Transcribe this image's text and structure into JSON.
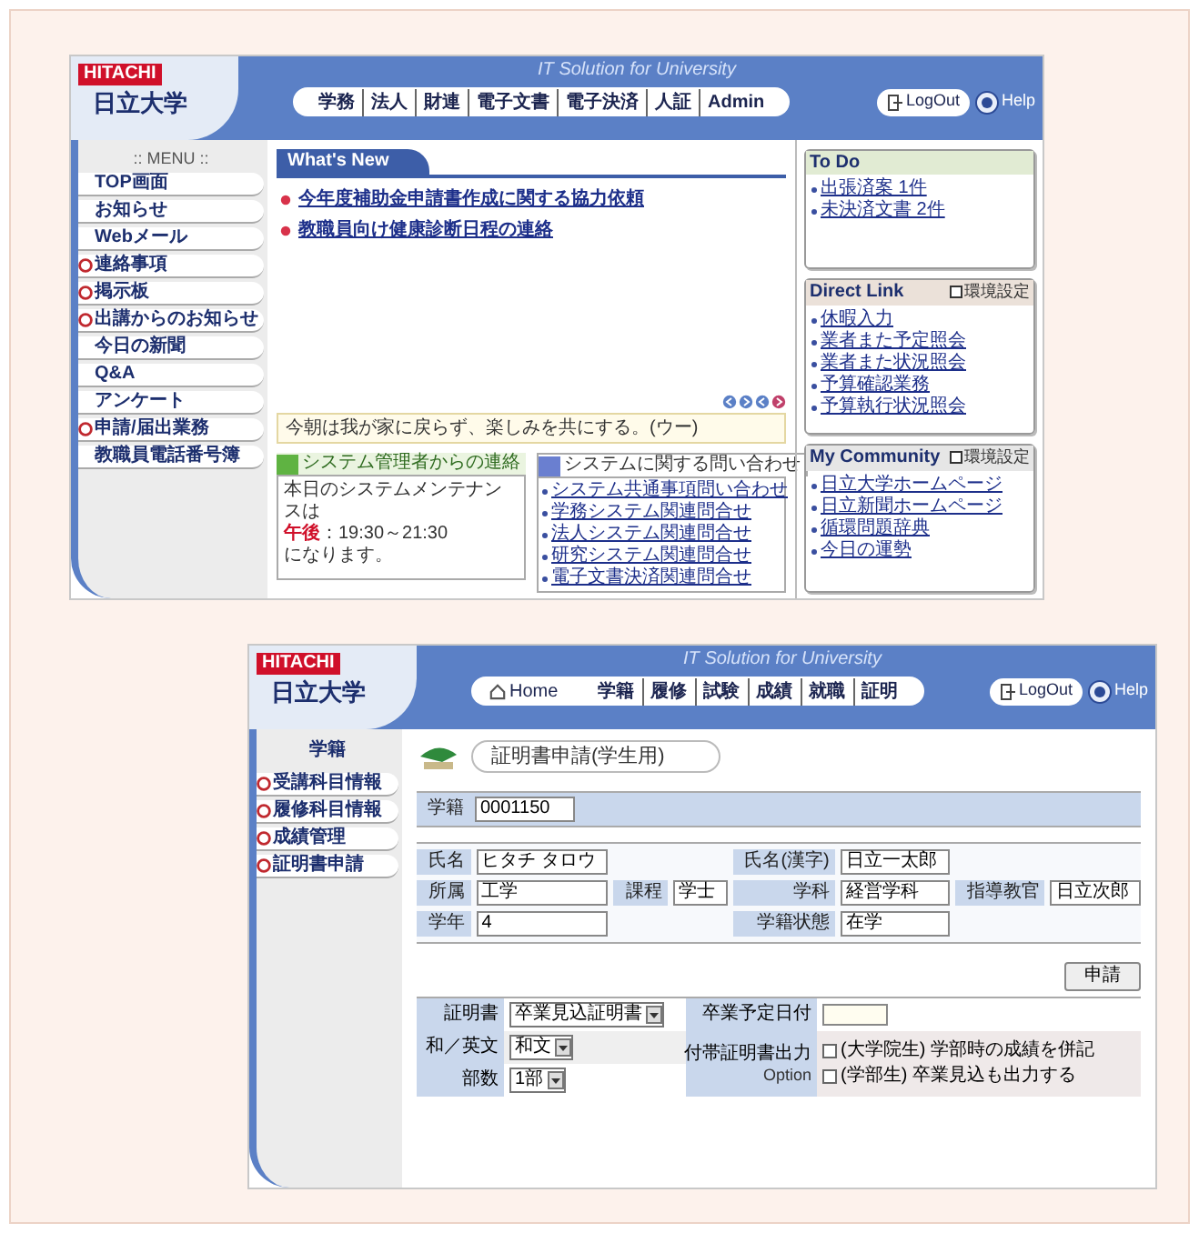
{
  "portal": {
    "header": {
      "brand": "HITACHI",
      "university": "日立大学",
      "tagline": "IT Solution for University",
      "nav": [
        "学務",
        "法人",
        "財連",
        "電子文書",
        "電子決済",
        "人証",
        "Admin"
      ],
      "logout": "LogOut",
      "help": "Help"
    },
    "menu": {
      "title": ":: MENU ::",
      "items": [
        {
          "label": "TOP画面",
          "kind": "link"
        },
        {
          "label": "お知らせ",
          "kind": "link"
        },
        {
          "label": "Webメール",
          "kind": "link"
        },
        {
          "label": "連絡事項",
          "kind": "group"
        },
        {
          "label": "掲示板",
          "kind": "group"
        },
        {
          "label": "出講からのお知らせ",
          "kind": "group"
        },
        {
          "label": "今日の新聞",
          "kind": "link"
        },
        {
          "label": "Q&A",
          "kind": "link"
        },
        {
          "label": "アンケート",
          "kind": "link"
        },
        {
          "label": "申請/届出業務",
          "kind": "group"
        },
        {
          "label": "教職員電話番号簿",
          "kind": "link"
        }
      ]
    },
    "whats_new": {
      "tab": "What's New",
      "items": [
        "今年度補助金申請書作成に関する協力依頼",
        "教職員向け健康診断日程の連絡"
      ]
    },
    "notice": "今朝は我が家に戻らず、楽しみを共にする。(ウー)",
    "admin_box": {
      "title": "システム管理者からの連絡",
      "message": "本日のシステムメンテナンスは",
      "time_label": "午後",
      "time": "：19:30～21:30",
      "closing": "になります。"
    },
    "inquiry_box": {
      "title": "システムに関する問い合わせ",
      "items": [
        "システム共通事項問い合わせ",
        "学務システム関連問合せ",
        "法人システム関連問合せ",
        "研究システム関連問合せ",
        "電子文書決済関連問合せ"
      ]
    },
    "panels": [
      {
        "title": "To Do",
        "items": [
          "出張済案 1件",
          "未決済文書 2件"
        ]
      },
      {
        "title": "Direct Link",
        "settings": "環境設定",
        "items": [
          "休暇入力",
          "業者また予定照会",
          "業者また状況照会",
          "予算確認業務",
          "予算執行状況照会"
        ]
      },
      {
        "title": "My Community",
        "settings": "環境設定",
        "items": [
          "日立大学ホームページ",
          "日立新聞ホームページ",
          "循環問題辞典",
          "今日の運勢"
        ]
      }
    ]
  },
  "certificate": {
    "header": {
      "brand": "HITACHI",
      "university": "日立大学",
      "tagline": "IT Solution for University",
      "home": "Home",
      "nav": [
        "学籍",
        "履修",
        "試験",
        "成績",
        "就職",
        "証明"
      ],
      "logout": "LogOut",
      "help": "Help"
    },
    "sidebar": {
      "title": "学籍",
      "items": [
        "受講科目情報",
        "履修科目情報",
        "成績管理",
        "証明書申請"
      ]
    },
    "page_title": "証明書申請(学生用)",
    "student_id": {
      "label": "学籍",
      "value": "0001150"
    },
    "profile_rows": [
      [
        {
          "label": "氏名",
          "value": "ヒタチ タロウ"
        },
        null,
        {
          "label": "氏名(漢字)",
          "value": "日立一太郎"
        },
        null
      ],
      [
        {
          "label": "所属",
          "value": "工学"
        },
        {
          "label": "課程",
          "value": "学士"
        },
        {
          "label": "学科",
          "value": "経営学科"
        },
        {
          "label": "指導教官",
          "value": "日立次郎"
        }
      ],
      [
        {
          "label": "学年",
          "value": "4"
        },
        null,
        {
          "label": "学籍状態",
          "value": "在学"
        },
        null
      ]
    ],
    "submit": "申請",
    "options": {
      "selects": [
        {
          "label": "証明書",
          "value": "卒業見込証明書"
        },
        {
          "label": "和／英文",
          "value": "和文"
        },
        {
          "label": "部数",
          "value": "1部"
        }
      ],
      "date": {
        "label": "卒業予定日付"
      },
      "extra": {
        "label": "付帯証明書出力",
        "note": "Option",
        "checks": [
          {
            "label": "(大学院生) 学部時の成績を併記",
            "checked": false
          },
          {
            "label": "(学部生) 卒業見込も出力する",
            "checked": false
          }
        ]
      }
    }
  }
}
